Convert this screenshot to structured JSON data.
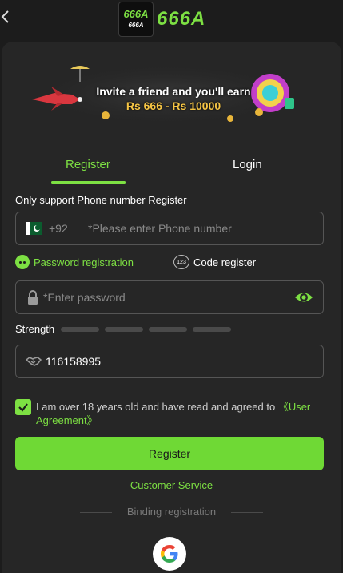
{
  "header": {
    "logo_badge_big": "666A",
    "logo_badge_small": "666A",
    "logo_text": "666A"
  },
  "banner": {
    "line1": "Invite a friend and you'll earn",
    "line2": "Rs 666 - Rs 10000"
  },
  "tabs": [
    {
      "label": "Register",
      "active": true
    },
    {
      "label": "Login",
      "active": false
    }
  ],
  "form": {
    "support_hint": "Only support Phone number Register",
    "country_code": "+92",
    "phone_placeholder": "*Please enter Phone number",
    "options": {
      "password_registration": "Password registration",
      "code_register": "Code register",
      "code_icon_text": "123"
    },
    "password_placeholder": "*Enter password",
    "strength_label": "Strength",
    "strength_level": 0,
    "invite_code": "116158995",
    "agreement_text": "I am over 18 years old and have read and agreed to ",
    "agreement_link": "《User Agreement》",
    "agreement_checked": true,
    "register_button": "Register"
  },
  "footer": {
    "customer_service": "Customer Service",
    "binding_label": "Binding registration"
  },
  "icons": {
    "back": "back-arrow-icon",
    "flag": "pakistan-flag-icon",
    "lock": "lock-icon",
    "eye": "eye-icon",
    "handshake": "handshake-icon",
    "google": "google-icon"
  },
  "colors": {
    "accent": "#7de043",
    "button": "#6fd935",
    "background": "#1c1c1c",
    "card": "#262626"
  }
}
